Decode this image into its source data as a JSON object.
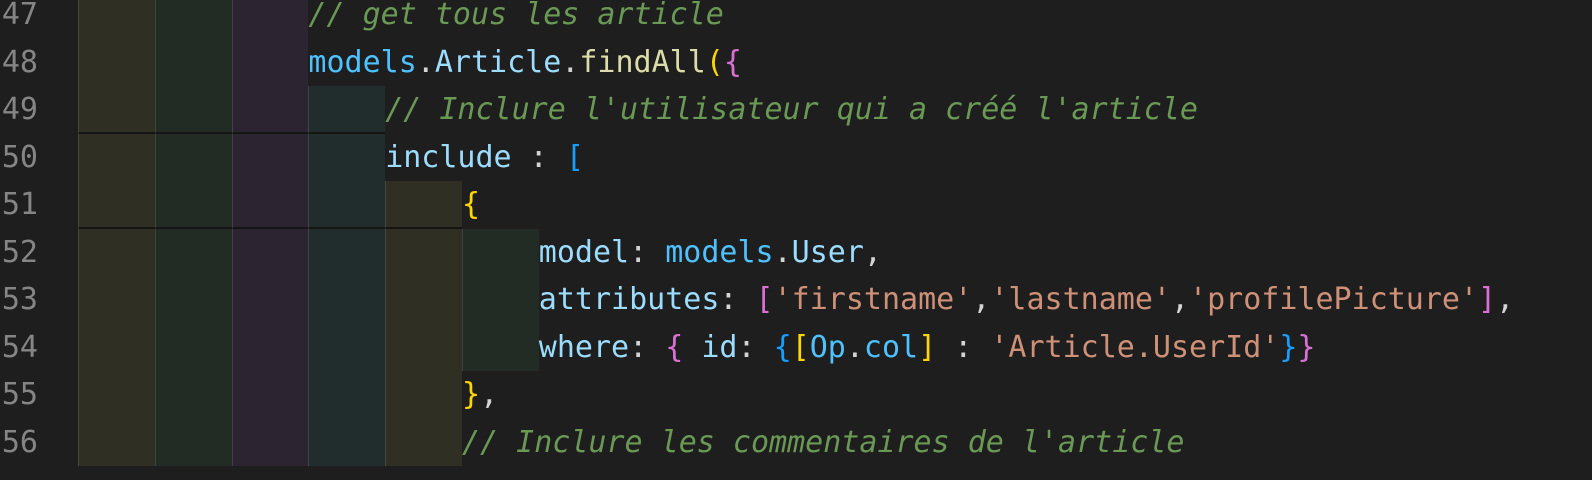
{
  "editor": {
    "colors": {
      "var": "#9cdcfe",
      "obj": "#4fc1ff",
      "fn": "#dcdcaa",
      "cm": "#6a9955",
      "str": "#ce9178",
      "p": "#d4d4d4",
      "b1": "#ffd700",
      "b2": "#da70d6",
      "b3": "#179fff"
    },
    "lines": [
      {
        "number": "47",
        "indent": 3,
        "tokens": [
          [
            "// get tous les article",
            "cm"
          ]
        ]
      },
      {
        "number": "48",
        "indent": 3,
        "tokens": [
          [
            "models",
            "obj"
          ],
          [
            ".",
            "p"
          ],
          [
            "Article",
            "var"
          ],
          [
            ".",
            "p"
          ],
          [
            "findAll",
            "fn"
          ],
          [
            "(",
            "b1"
          ],
          [
            "{",
            "b2"
          ]
        ]
      },
      {
        "number": "49",
        "indent": 4,
        "sep": true,
        "tokens": [
          [
            "// Inclure l'utilisateur qui a créé l'article",
            "cm"
          ]
        ]
      },
      {
        "number": "50",
        "indent": 4,
        "tokens": [
          [
            "include",
            "var"
          ],
          [
            " : ",
            "p"
          ],
          [
            "[",
            "b3"
          ]
        ]
      },
      {
        "number": "51",
        "indent": 5,
        "sep": true,
        "tokens": [
          [
            "{",
            "b1"
          ]
        ]
      },
      {
        "number": "52",
        "indent": 6,
        "tokens": [
          [
            "model",
            "var"
          ],
          [
            ": ",
            "p"
          ],
          [
            "models",
            "obj"
          ],
          [
            ".",
            "p"
          ],
          [
            "User",
            "var"
          ],
          [
            ",",
            "p"
          ]
        ]
      },
      {
        "number": "53",
        "indent": 6,
        "tokens": [
          [
            "attributes",
            "var"
          ],
          [
            ": ",
            "p"
          ],
          [
            "[",
            "b2"
          ],
          [
            "'firstname'",
            "str"
          ],
          [
            ",",
            "p"
          ],
          [
            "'lastname'",
            "str"
          ],
          [
            ",",
            "p"
          ],
          [
            "'profilePicture'",
            "str"
          ],
          [
            "]",
            "b2"
          ],
          [
            ",",
            "p"
          ]
        ]
      },
      {
        "number": "54",
        "indent": 6,
        "tokens": [
          [
            "where",
            "var"
          ],
          [
            ": ",
            "p"
          ],
          [
            "{",
            "b2"
          ],
          [
            " ",
            "p"
          ],
          [
            "id",
            "var"
          ],
          [
            ": ",
            "p"
          ],
          [
            "{",
            "b3"
          ],
          [
            "[",
            "b1"
          ],
          [
            "Op",
            "obj"
          ],
          [
            ".",
            "p"
          ],
          [
            "col",
            "obj"
          ],
          [
            "]",
            "b1"
          ],
          [
            " : ",
            "p"
          ],
          [
            "'Article.UserId'",
            "str"
          ],
          [
            "}",
            "b3"
          ],
          [
            "}",
            "b2"
          ]
        ]
      },
      {
        "number": "55",
        "indent": 5,
        "tokens": [
          [
            "}",
            "b1"
          ],
          [
            ",",
            "p"
          ]
        ]
      },
      {
        "number": "56",
        "indent": 5,
        "tokens": [
          [
            "// Inclure les commentaires de l'article",
            "cm"
          ]
        ]
      }
    ]
  }
}
